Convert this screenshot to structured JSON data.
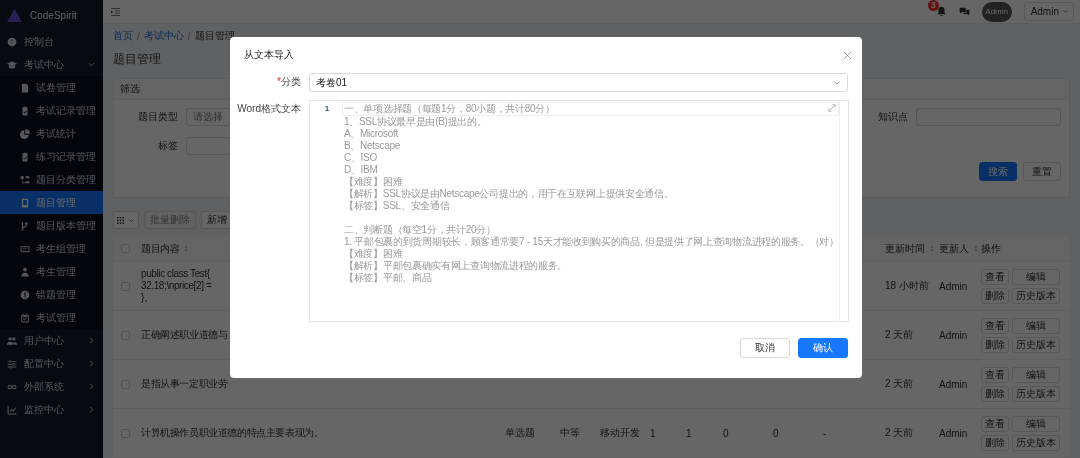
{
  "sidebar": {
    "logo": "CodeSpirit",
    "items": [
      {
        "label": "控制台",
        "kind": "link",
        "selected": false
      },
      {
        "label": "考试中心",
        "kind": "group",
        "selected": false,
        "expanded": true,
        "children": [
          {
            "label": "试卷管理",
            "selected": false
          },
          {
            "label": "考试记录管理",
            "selected": false
          },
          {
            "label": "考试统计",
            "selected": false
          },
          {
            "label": "练习记录管理",
            "selected": false
          },
          {
            "label": "题目分类管理",
            "selected": false
          },
          {
            "label": "题目管理",
            "selected": true
          },
          {
            "label": "题目版本管理",
            "selected": false
          },
          {
            "label": "考生组管理",
            "selected": false
          },
          {
            "label": "考生管理",
            "selected": false
          },
          {
            "label": "错题管理",
            "selected": false
          },
          {
            "label": "考试管理",
            "selected": false
          }
        ]
      },
      {
        "label": "用户中心",
        "kind": "group",
        "selected": false,
        "expanded": false
      },
      {
        "label": "配置中心",
        "kind": "group",
        "selected": false,
        "expanded": false
      },
      {
        "label": "外部系统",
        "kind": "group",
        "selected": false,
        "expanded": false
      },
      {
        "label": "监控中心",
        "kind": "group",
        "selected": false,
        "expanded": false
      }
    ]
  },
  "topbar": {
    "notification_count": "3",
    "avatar_text": "Admin",
    "user": "Admin"
  },
  "breadcrumb_separator": "/",
  "breadcrumb": [
    {
      "label": "首页",
      "link": true
    },
    {
      "label": "考试中心",
      "link": true
    },
    {
      "label": "题目管理",
      "link": false
    }
  ],
  "page_title": "题目管理",
  "filter": {
    "title": "筛选",
    "rows": [
      [
        {
          "label": "题目类型",
          "placeholder": "请选择"
        },
        {
          "label": "知识点"
        }
      ],
      [
        {
          "label": "标签"
        }
      ]
    ],
    "buttons": [
      {
        "label": "搜索",
        "primary": true
      },
      {
        "label": "重置",
        "primary": false
      }
    ]
  },
  "toolbar": {
    "buttons": [
      {
        "label": "批量删除",
        "disabled": true
      },
      {
        "label": "新增",
        "disabled": false
      }
    ]
  },
  "table": {
    "select_all_checked": false,
    "columns": [
      {
        "label": "题目内容",
        "sortable": true
      },
      {
        "label": "更新时间",
        "sortable": true
      },
      {
        "label": "更新人",
        "sortable": true
      },
      {
        "label": "操作",
        "sortable": false
      }
    ],
    "rows": [
      {
        "checked": false,
        "content": [
          "public class Test{",
          "32.18;\\nprice[2] =",
          "}。"
        ],
        "cells": [],
        "updated": "18 小时前",
        "updater": "Admin",
        "actions": [
          "查看",
          "编辑",
          "删除",
          "历史版本"
        ]
      },
      {
        "checked": false,
        "content": [
          "正确阐述职业道德与"
        ],
        "cells": [],
        "updated": "2 天前",
        "updater": "Admin",
        "actions": [
          "查看",
          "编辑",
          "删除",
          "历史版本"
        ]
      },
      {
        "checked": false,
        "content": [
          "是指从事一定职业劳"
        ],
        "cells": [],
        "updated": "2 天前",
        "updater": "Admin",
        "actions": [
          "查看",
          "编辑",
          "删除",
          "历史版本"
        ]
      },
      {
        "checked": false,
        "content": [
          "计算机操作员职业道德的特点主要表现为。"
        ],
        "cells": [
          "单选题",
          "中等",
          "移动开发",
          "1",
          "1",
          "0",
          "0",
          "-"
        ],
        "updated": "2 天前",
        "updater": "Admin",
        "actions": [
          "查看",
          "编辑",
          "删除",
          "历史版本"
        ]
      }
    ]
  },
  "modal": {
    "title": "从文本导入",
    "required_mark": "*",
    "fields": [
      {
        "label": "分类",
        "required": true,
        "kind": "select",
        "value": "考卷01"
      },
      {
        "label": "Word格式文本",
        "required": false,
        "kind": "editor",
        "line_number": "1",
        "paragraphs": [
          [
            "一、单项选择题（每题1分，80小题，共计80分）",
            "1、SSL协议最早是由(B)提出的。",
            "A、Microsoft",
            "B、Netscape",
            "C、ISO",
            "D、IBM",
            "【难度】困难",
            "【解析】SSL协议是由Netscape公司提出的，用于在互联网上提供安全通信。",
            "【标签】SSL、安全通信"
          ],
          [
            "二、判断题（每空1分，共计20分）",
            "1. 平邮包裹的到货周期较长，顾客通常要7 - 15天才能收到购买的商品, 但是提供了网上查询物流进程的服务。（对）",
            "【难度】困难",
            "【解析】平邮包裹确实有网上查询物流进程的服务。",
            "【标签】平邮、商品"
          ]
        ]
      }
    ],
    "buttons": [
      {
        "label": "取消",
        "primary": false
      },
      {
        "label": "确认",
        "primary": true
      }
    ]
  }
}
